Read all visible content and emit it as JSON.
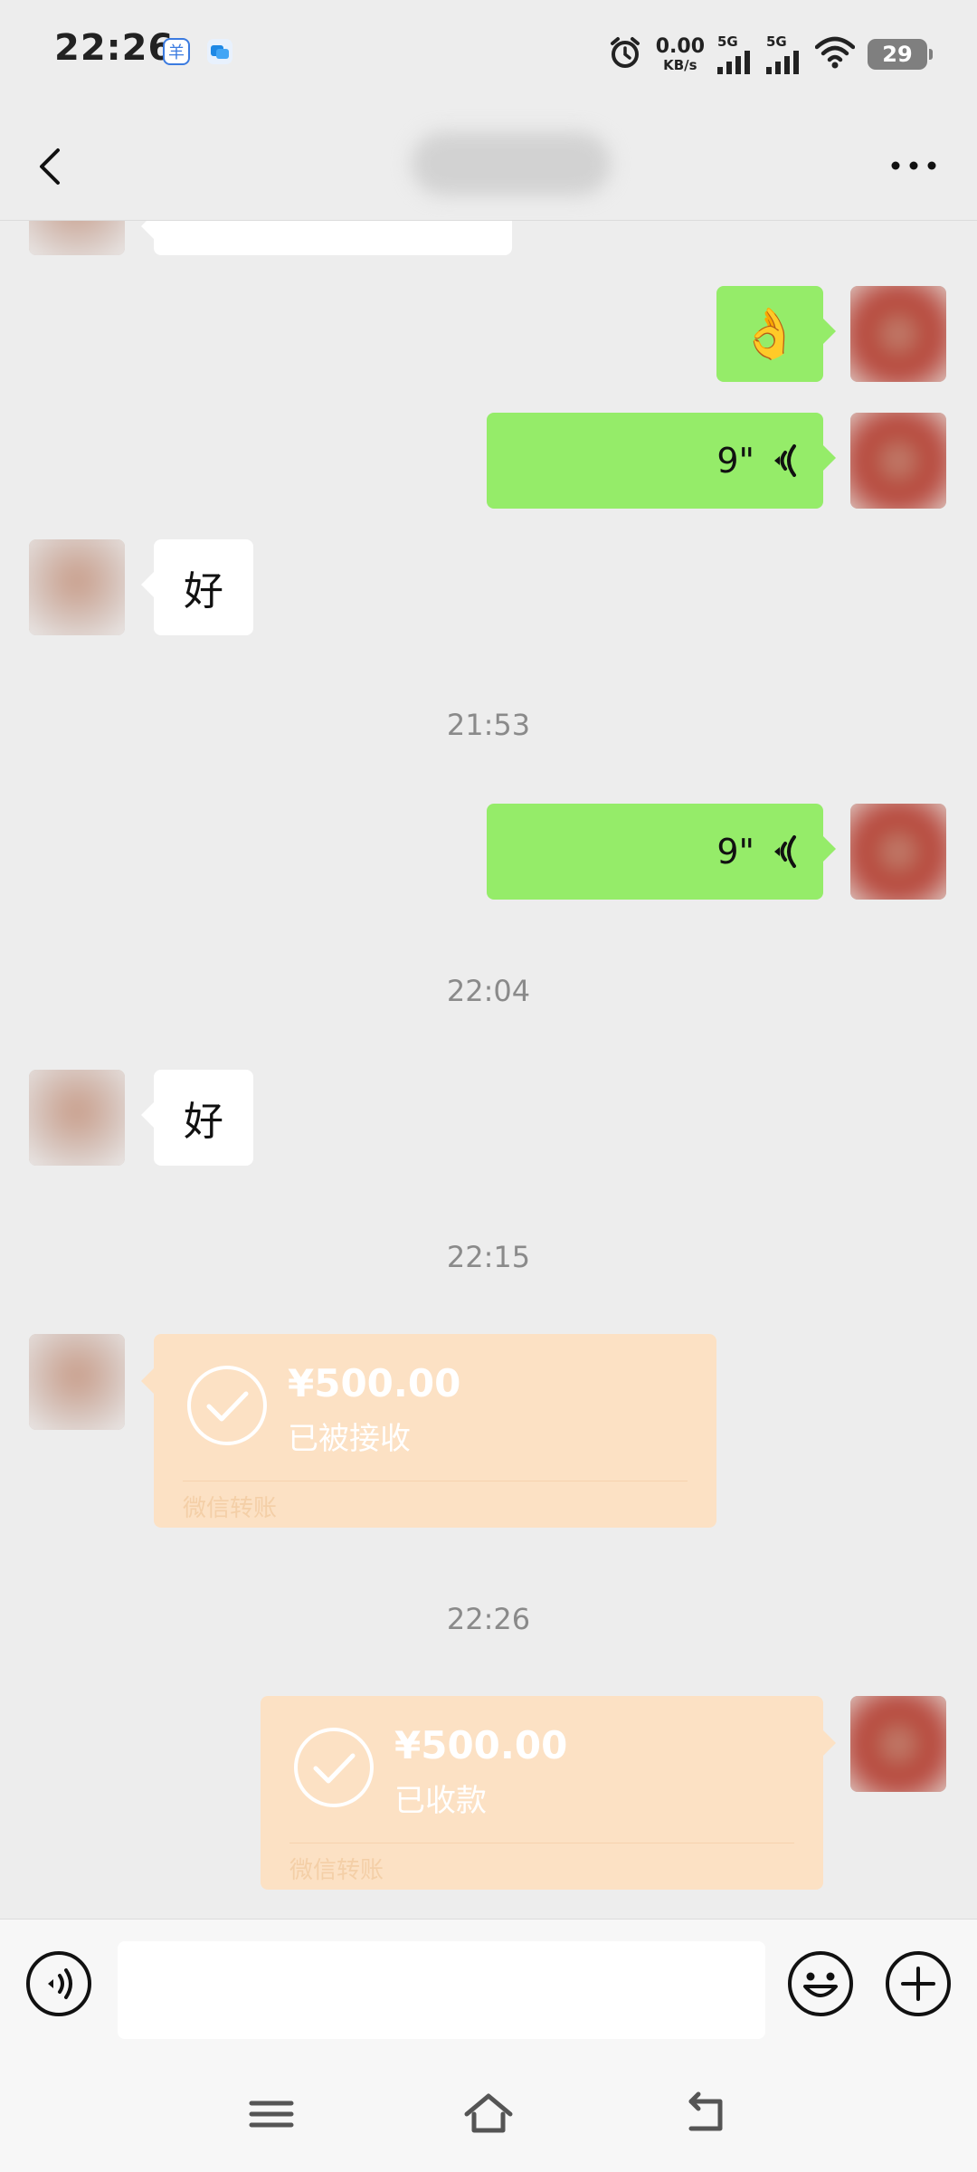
{
  "status_bar": {
    "time": "22:26",
    "net_speed_value": "0.00",
    "net_speed_unit": "KB/s",
    "sim1_label": "5G",
    "sim2_label": "5G",
    "battery": "29"
  },
  "header": {
    "back_icon": "chevron-left-icon",
    "more_icon": "ellipsis-icon"
  },
  "messages": [
    {
      "type": "emoji",
      "side": "right",
      "emoji": "👌"
    },
    {
      "type": "voice",
      "side": "right",
      "duration": "9\""
    },
    {
      "type": "text",
      "side": "left",
      "text": "好"
    },
    {
      "type": "time",
      "text": "21:53"
    },
    {
      "type": "voice",
      "side": "right",
      "duration": "9\""
    },
    {
      "type": "time",
      "text": "22:04"
    },
    {
      "type": "text",
      "side": "left",
      "text": "好"
    },
    {
      "type": "time",
      "text": "22:15"
    },
    {
      "type": "transfer",
      "side": "left",
      "amount": "¥500.00",
      "status": "已被接收",
      "brand": "微信转账"
    },
    {
      "type": "time",
      "text": "22:26"
    },
    {
      "type": "transfer",
      "side": "right",
      "amount": "¥500.00",
      "status": "已收款",
      "brand": "微信转账"
    }
  ],
  "input_bar": {
    "voice_icon": "voice-mode-icon",
    "emoji_icon": "emoji-icon",
    "plus_icon": "plus-icon",
    "text_value": ""
  },
  "nav_bar": {
    "icons": [
      "menu-icon",
      "home-icon",
      "back-icon"
    ]
  }
}
